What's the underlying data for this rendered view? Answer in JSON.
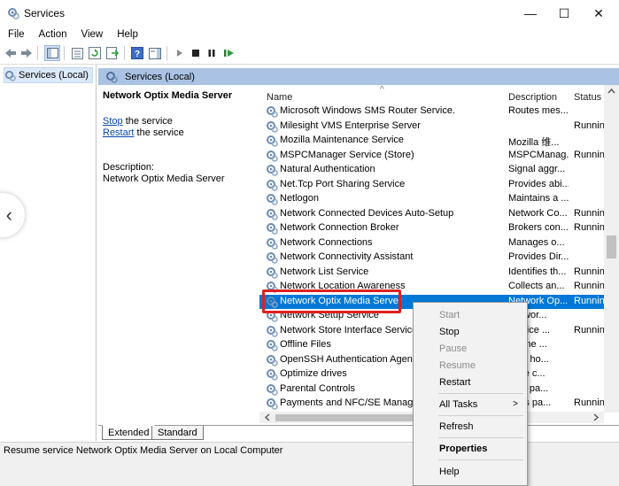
{
  "window": {
    "title": "Services",
    "icon": "gear-services-icon"
  },
  "window_controls": [
    "—",
    "☐",
    "✕"
  ],
  "menu": [
    "File",
    "Action",
    "View",
    "Help"
  ],
  "toolbar": {
    "icons": [
      "back-arrow-icon",
      "forward-arrow-icon",
      "show-hide-tree-icon",
      "properties-icon",
      "refresh-icon",
      "export-list-icon",
      "help-icon",
      "show-action-pane-icon",
      "start-service-icon",
      "stop-service-icon",
      "pause-service-icon",
      "restart-service-icon"
    ]
  },
  "tree": {
    "item": "Services (Local)"
  },
  "main_header": "Services (Local)",
  "detail": {
    "title": "Network Optix Media Server",
    "stop_link": "Stop",
    "stop_rest": " the service",
    "restart_link": "Restart",
    "restart_rest": " the service",
    "description_label": "Description:",
    "description_text": "Network Optix Media Server"
  },
  "columns": {
    "name": "Name",
    "description": "Description",
    "status": "Status",
    "sort_indicator": "^"
  },
  "services": [
    {
      "name": "Microsoft Windows SMS Router Service.",
      "description": "Routes mes...",
      "status": ""
    },
    {
      "name": "Milesight VMS Enterprise Server",
      "description": "",
      "status": "Running"
    },
    {
      "name": "Mozilla Maintenance Service",
      "description": "Mozilla 维...",
      "status": ""
    },
    {
      "name": "MSPCManager Service (Store)",
      "description": "MSPCManag...",
      "status": "Running"
    },
    {
      "name": "Natural Authentication",
      "description": "Signal aggr...",
      "status": ""
    },
    {
      "name": "Net.Tcp Port Sharing Service",
      "description": "Provides abi...",
      "status": ""
    },
    {
      "name": "Netlogon",
      "description": "Maintains a ...",
      "status": ""
    },
    {
      "name": "Network Connected Devices Auto-Setup",
      "description": "Network Co...",
      "status": "Running"
    },
    {
      "name": "Network Connection Broker",
      "description": "Brokers con...",
      "status": "Running"
    },
    {
      "name": "Network Connections",
      "description": "Manages o...",
      "status": ""
    },
    {
      "name": "Network Connectivity Assistant",
      "description": "Provides Dir...",
      "status": ""
    },
    {
      "name": "Network List Service",
      "description": "Identifies th...",
      "status": "Running"
    },
    {
      "name": "Network Location Awareness",
      "description": "Collects an...",
      "status": "Running"
    },
    {
      "name": "Network Optix Media Server",
      "description": "Network Op...",
      "status": "Running"
    },
    {
      "name": "Network Setup Service",
      "description": "Networ...",
      "status": ""
    },
    {
      "name": "Network Store Interface Service",
      "description": "service ...",
      "status": "Running"
    },
    {
      "name": "Offline Files",
      "description": "Offline ...",
      "status": ""
    },
    {
      "name": "OpenSSH Authentication Agent",
      "description": "nt to ho...",
      "status": ""
    },
    {
      "name": "Optimize drives",
      "description": "s the c...",
      "status": ""
    },
    {
      "name": "Parental Controls",
      "description": "rces pa...",
      "status": ""
    },
    {
      "name": "Payments and NFC/SE Manager",
      "description": "ages pa...",
      "status": "Runnin"
    }
  ],
  "selected_index": 13,
  "tabs": [
    "Extended",
    "Standard"
  ],
  "status_bar": "Resume service Network Optix Media Server on Local Computer",
  "context_menu": {
    "items": [
      {
        "label": "Start",
        "enabled": false
      },
      {
        "label": "Stop",
        "enabled": true
      },
      {
        "label": "Pause",
        "enabled": false
      },
      {
        "label": "Resume",
        "enabled": false
      },
      {
        "label": "Restart",
        "enabled": true
      },
      {
        "label": "All Tasks",
        "enabled": true,
        "submenu": true
      },
      {
        "label": "Refresh",
        "enabled": true
      },
      {
        "label": "Properties",
        "enabled": true,
        "bold": true
      },
      {
        "label": "Help",
        "enabled": true
      }
    ],
    "submenu_arrow": ">"
  },
  "colors": {
    "selection": "#0078d7",
    "header": "#aac3e4",
    "highlight_box": "#e02020",
    "link": "#0645ad"
  }
}
